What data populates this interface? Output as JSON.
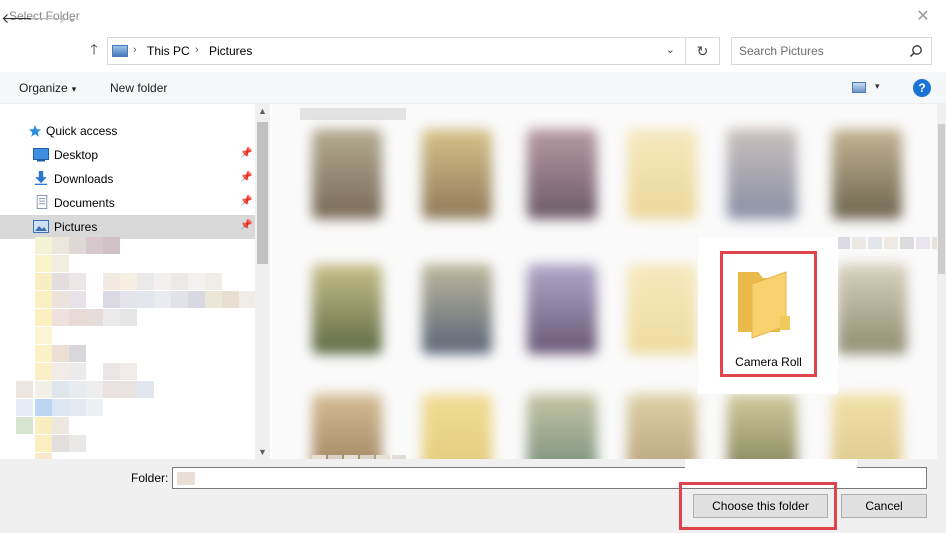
{
  "window": {
    "title": "Select Folder",
    "close_symbol": "✕"
  },
  "nav": {
    "back": "🡐",
    "forward": "🡒",
    "recent": "⌄",
    "up": "🡑",
    "breadcrumb": [
      "This PC",
      "Pictures"
    ],
    "separator": "›",
    "dropdown": "⌄",
    "refresh": "↻"
  },
  "search": {
    "placeholder": "Search Pictures"
  },
  "toolbar": {
    "organize_label": "Organize",
    "caret": "▾",
    "new_folder_label": "New folder",
    "help_label": "?"
  },
  "sidebar": {
    "items": [
      {
        "label": "Quick access",
        "icon": "star-icon"
      },
      {
        "label": "Desktop",
        "icon": "desktop-icon",
        "pinned": true
      },
      {
        "label": "Downloads",
        "icon": "download-icon",
        "pinned": true
      },
      {
        "label": "Documents",
        "icon": "documents-icon",
        "pinned": true
      },
      {
        "label": "Pictures",
        "icon": "pictures-icon",
        "pinned": true,
        "selected": true
      }
    ],
    "pin_symbol": "📌"
  },
  "content": {
    "highlighted_folder": {
      "label": "Camera Roll",
      "icon": "folder-icon"
    }
  },
  "footer": {
    "folder_label": "Folder:",
    "choose_label": "Choose this folder",
    "cancel_label": "Cancel"
  },
  "colors": {
    "highlight": "#e0444c",
    "selection": "#d9d9d9",
    "help_blue": "#1b73d3",
    "folder_yellow": "#f7d26e"
  }
}
